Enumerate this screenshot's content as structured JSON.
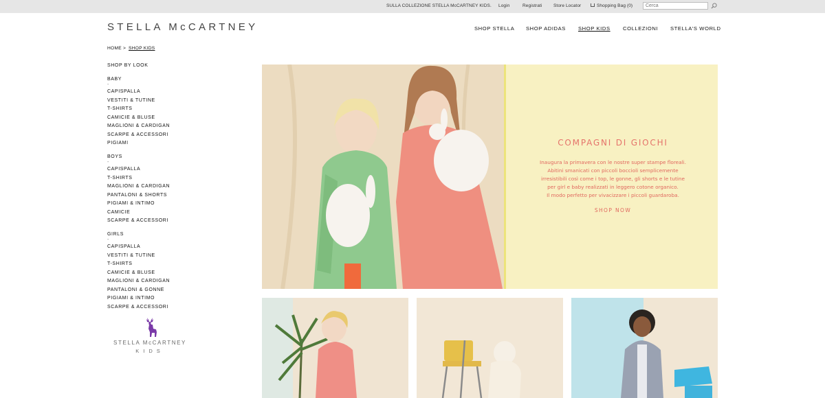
{
  "topbar": {
    "promo": "SULLA COLLEZIONE STELLA McCARTNEY KIDS.",
    "login": "Login",
    "register": "Registrati",
    "store_locator": "Store Locator",
    "shopping_bag": "Shopping Bag (0)",
    "search_placeholder": "Cerca"
  },
  "header": {
    "logo": "STELLA McCARTNEY",
    "nav": [
      "SHOP STELLA",
      "SHOP ADIDAS",
      "SHOP KIDS",
      "COLLEZIONI",
      "STELLA'S WORLD"
    ]
  },
  "breadcrumb": {
    "home": "HOME",
    "separator": ">",
    "current": "SHOP KIDS"
  },
  "sidebar": {
    "shop_by_look": "SHOP BY LOOK",
    "dash": "-",
    "baby": {
      "title": "BABY",
      "items": [
        "CAPISPALLA",
        "VESTITI & TUTINE",
        "T-SHIRTS",
        "CAMICIE & BLUSE",
        "MAGLIONI & CARDIGAN",
        "SCARPE & ACCESSORI",
        "PIGIAMI"
      ]
    },
    "boys": {
      "title": "BOYS",
      "items": [
        "CAPISPALLA",
        "T-SHIRTS",
        "MAGLIONI & CARDIGAN",
        "PANTALONI & SHORTS",
        "PIGIAMI & INTIMO",
        "CAMICIE",
        "SCARPE & ACCESSORI"
      ]
    },
    "girls": {
      "title": "GIRLS",
      "items": [
        "CAPISPALLA",
        "VESTITI & TUTINE",
        "T-SHIRTS",
        "CAMICIE & BLUSE",
        "MAGLIONI & CARDIGAN",
        "PANTALONI & GONNE",
        "PIGIAMI & INTIMO",
        "SCARPE & ACCESSORI"
      ]
    },
    "kids_logo": {
      "wordmark": "STELLA McCARTNEY",
      "sub": "KIDS"
    }
  },
  "hero": {
    "title": "COMPAGNI DI GIOCHI",
    "copy": [
      "Inaugura la primavera con le nostre super stampe floreali.",
      "Abitini smanicati con piccoli boccioli semplicemente",
      "irresistibili così come i top,  le gonne, gli shorts e le tutine",
      "per girl e baby realizzati in leggero cotone organico.",
      "Il modo perfetto per vivacizzare i piccoli guardaroba."
    ],
    "cta": "SHOP NOW"
  },
  "colors": {
    "topbar_bg": "#e6e6e6",
    "hero_panel": "#f8f1c2",
    "hero_text": "#e0675e",
    "deer_purple": "#7a3aa8"
  }
}
